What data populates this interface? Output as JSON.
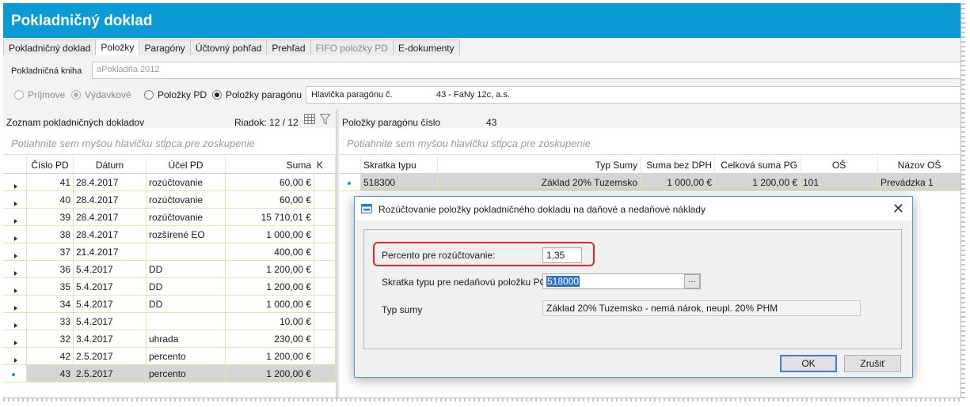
{
  "window": {
    "title": "Pokladničný doklad"
  },
  "tabs": [
    {
      "label": "Pokladničný doklad",
      "state": "normal"
    },
    {
      "label": "Položky",
      "state": "active"
    },
    {
      "label": "Paragóny",
      "state": "normal"
    },
    {
      "label": "Účtovný pohľad",
      "state": "normal"
    },
    {
      "label": "Prehľad",
      "state": "normal"
    },
    {
      "label": "FIFO položky PD",
      "state": "disabled"
    },
    {
      "label": "E-dokumenty",
      "state": "normal"
    }
  ],
  "kniha": {
    "label": "Pokladničná kniha",
    "value": "aPokladňa 2012"
  },
  "radios": [
    {
      "label": "Príjmove",
      "checked": false,
      "disabled": true
    },
    {
      "label": "Výdavkové",
      "checked": true,
      "disabled": true
    },
    {
      "label": "Položky PD",
      "checked": false,
      "disabled": false
    },
    {
      "label": "Položky paragónu",
      "checked": true,
      "disabled": false
    }
  ],
  "hlavicka": {
    "label": "Hlavička paragónu č.",
    "value": "43 - FaNy 12c, a.s."
  },
  "left_panel": {
    "title": "Zoznam pokladničných dokladov",
    "riadok": "Riadok: 12 / 12",
    "group_hint": "Potiahnite sem myšou hlavičku stĺpca pre zoskupenie",
    "columns": [
      "Číslo PD",
      "Dátum",
      "Účel PD",
      "Suma",
      "K"
    ],
    "rows": [
      [
        "41",
        "28.4.2017",
        "rozúčtovanie",
        "60,00 €"
      ],
      [
        "40",
        "28.4.2017",
        "rozúčtovanie",
        "60,00 €"
      ],
      [
        "39",
        "28.4.2017",
        "rozúčtovanie",
        "15 710,01 €"
      ],
      [
        "38",
        "28.4.2017",
        "rozšírené EO",
        "1 000,00 €"
      ],
      [
        "37",
        "21.4.2017",
        "",
        "400,00 €"
      ],
      [
        "36",
        "5.4.2017",
        "DD",
        "1 200,00 €"
      ],
      [
        "35",
        "5.4.2017",
        "DD",
        "1 200,00 €"
      ],
      [
        "34",
        "5.4.2017",
        "DD",
        "1 000,00 €"
      ],
      [
        "33",
        "5.4.2017",
        "",
        "10,00 €"
      ],
      [
        "32",
        "3.4.2017",
        "uhrada",
        "230,00 €"
      ],
      [
        "42",
        "2.5.2017",
        "percento",
        "1 200,00 €"
      ],
      [
        "43",
        "2.5.2017",
        "percento",
        "1 200,00 €"
      ]
    ],
    "selected_index": 11
  },
  "right_panel": {
    "title": "Položky paragónu číslo",
    "number": "43",
    "group_hint": "Potiahnite sem myšou hlavičku stĺpca pre zoskupenie",
    "columns": [
      "Skratka typu",
      "Typ Sumy",
      "Suma bez DPH",
      "Celková suma PG",
      "OŠ",
      "Názov OŠ"
    ],
    "rows": [
      [
        "518300",
        "Základ 20% Tuzemsko",
        "1 000,00 €",
        "1 200,00 €",
        "101",
        "Prevádzka 1"
      ]
    ]
  },
  "dialog": {
    "title": "Rozúčtovanie položky pokladničného dokladu na daňové a nedaňové náklady",
    "fields": {
      "percento_label": "Percento pre rozúčtovanie:",
      "percento_value": "1,35",
      "skratka_label": "Skratka typu pre nedaňovú položku PG:",
      "skratka_value": "518000",
      "typ_label": "Typ sumy",
      "typ_value": "Základ 20% Tuzemsko - nemá nárok, neupl. 20% PHM"
    },
    "ellipsis": "...",
    "ok_label": "OK",
    "cancel_label": "Zrušiť",
    "highlight_color": "#d92b2b"
  },
  "colors": {
    "accent": "#0a9ad6",
    "grid_line": "#e6e2a8",
    "selection": "#d5d5d5"
  }
}
